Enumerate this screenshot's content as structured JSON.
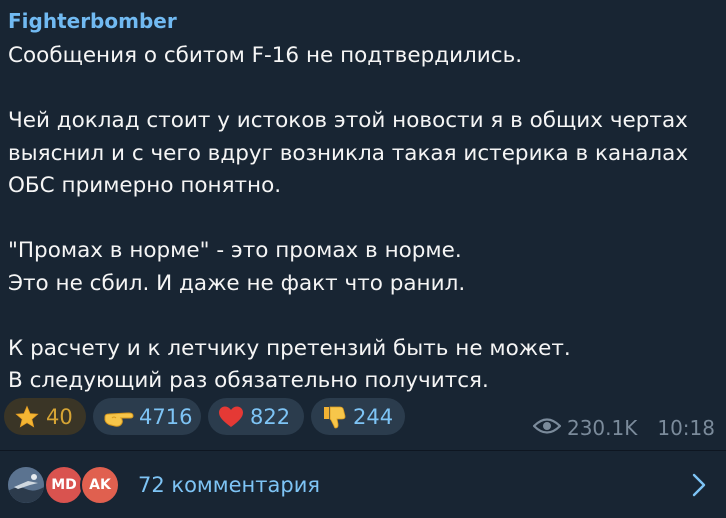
{
  "channel": {
    "name": "Fighterbomber"
  },
  "message": {
    "paragraphs": [
      "Сообщения о сбитом F-16 не подтвердились.",
      "Чей доклад стоит у истоков этой  новости я в общих чертах\nвыяснил и с чего вдруг возникла такая истерика в каналах\nОБС примерно понятно.",
      "\"Промах в норме\" - это промах в норме.\nЭто не сбил. И даже не факт что ранил.",
      "К расчету и к летчику претензий быть не может.\nВ следующий раз обязательно получится."
    ]
  },
  "reactions": [
    {
      "icon": "star-icon",
      "count": "40"
    },
    {
      "icon": "gun-hand-icon",
      "count": "4716"
    },
    {
      "icon": "red-heart-icon",
      "count": "822"
    },
    {
      "icon": "thumbs-down-icon",
      "count": "244"
    }
  ],
  "meta": {
    "views": "230.1K",
    "time": "10:18",
    "icon": "eye-icon"
  },
  "comments": {
    "label": "72 комментария",
    "avatars": [
      {
        "initials": "",
        "color": "#3a4d66"
      },
      {
        "initials": "MD",
        "color": "#d9534f"
      },
      {
        "initials": "AK",
        "color": "#e0604f"
      }
    ],
    "icon": "chevron-right-icon"
  },
  "colors": {
    "background": "#182533",
    "channel_name": "#71baf2",
    "accent": "#7ec4f5",
    "meta": "#7b8b9b"
  }
}
